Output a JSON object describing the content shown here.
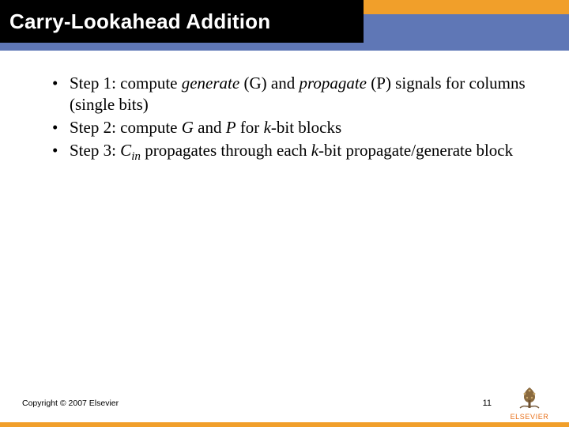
{
  "header": {
    "title": "Carry-Lookahead Addition"
  },
  "bullets": {
    "s1_pre": "Step 1: compute ",
    "s1_gen": "generate",
    "s1_mid1": " (G) and ",
    "s1_prop": "propagate",
    "s1_post": " (P) signals for columns (single bits)",
    "s2_pre": "Step 2: compute ",
    "s2_g": "G",
    "s2_mid": " and ",
    "s2_p": "P",
    "s2_for": " for ",
    "s2_k": "k",
    "s2_post": "-bit blocks",
    "s3_pre": "Step 3: ",
    "s3_c": "C",
    "s3_sub": "in",
    "s3_mid": " propagates through each ",
    "s3_k": "k",
    "s3_post": "-bit propagate/generate block"
  },
  "footer": {
    "copyright": "Copyright © 2007 Elsevier",
    "page": "11",
    "publisher": "ELSEVIER"
  }
}
